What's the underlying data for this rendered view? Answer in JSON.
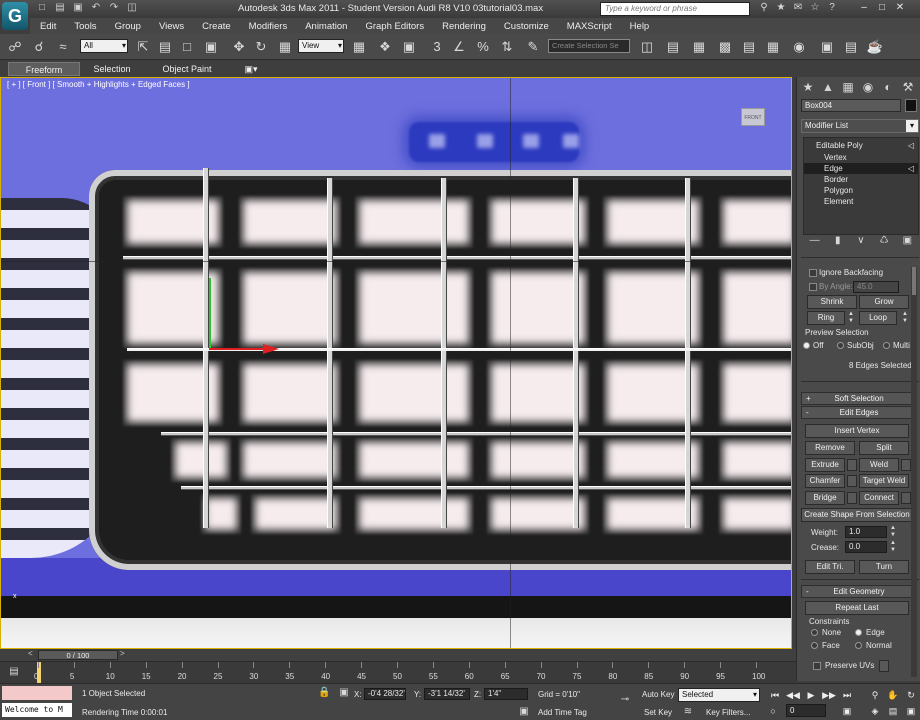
{
  "window": {
    "title": "Autodesk 3ds Max  2011   - Student Version    Audi R8 V10 03tutorial03.max",
    "search_placeholder": "Type a keyword or phrase",
    "app_logo": "G"
  },
  "menu": [
    "Edit",
    "Tools",
    "Group",
    "Views",
    "Create",
    "Modifiers",
    "Animation",
    "Graph Editors",
    "Rendering",
    "Customize",
    "MAXScript",
    "Help"
  ],
  "toolbar": {
    "selection_filter": "All",
    "ref_coord": "View",
    "named_selection_placeholder": "Create Selection Se",
    "snap_label": "3",
    "percent_label": "%"
  },
  "ribbon": {
    "tabs": [
      "Freeform",
      "Selection",
      "Object Paint"
    ],
    "active": "Freeform"
  },
  "viewport": {
    "label": "[ + ] [ Front ] [ Smooth + Highlights + Edged Faces ]",
    "viewcube_label": "FRONT",
    "axis_label": "x"
  },
  "command_panel": {
    "object_name": "Box004",
    "modifier_list": "Modifier List",
    "stack": {
      "base": "Editable Poly",
      "subs": [
        "Vertex",
        "Edge",
        "Border",
        "Polygon",
        "Element"
      ],
      "active": "Edge"
    },
    "selection": {
      "ignore_backfacing": "Ignore Backfacing",
      "by_angle": "By Angle:",
      "by_angle_value": "45.0",
      "shrink": "Shrink",
      "grow": "Grow",
      "ring": "Ring",
      "loop": "Loop",
      "preview_selection": "Preview Selection",
      "preview_options": [
        "Off",
        "SubObj",
        "Multi"
      ],
      "status": "8 Edges Selected"
    },
    "soft_selection": "Soft Selection",
    "edit_edges": {
      "title": "Edit Edges",
      "insert_vertex": "Insert Vertex",
      "remove": "Remove",
      "split": "Split",
      "extrude": "Extrude",
      "weld": "Weld",
      "chamfer": "Chamfer",
      "target_weld": "Target Weld",
      "bridge": "Bridge",
      "connect": "Connect",
      "create_shape": "Create Shape From Selection",
      "weight_label": "Weight:",
      "weight_value": "1.0",
      "crease_label": "Crease:",
      "crease_value": "0.0",
      "edit_tri": "Edit Tri.",
      "turn": "Turn"
    },
    "edit_geometry": {
      "title": "Edit Geometry",
      "repeat_last": "Repeat Last",
      "constraints": "Constraints",
      "options": [
        "None",
        "Edge",
        "Face",
        "Normal"
      ],
      "preserve_uvs": "Preserve UVs"
    }
  },
  "timeline": {
    "slider": "0 / 100",
    "ticks": [
      "0",
      "5",
      "10",
      "15",
      "20",
      "25",
      "30",
      "35",
      "40",
      "45",
      "50",
      "55",
      "60",
      "65",
      "70",
      "75",
      "80",
      "85",
      "90",
      "95",
      "100"
    ]
  },
  "status": {
    "listener_output": "Welcome to M",
    "selection": "1 Object Selected",
    "render_time": "Rendering Time  0:00:01",
    "x_label": "X:",
    "x_value": "-0'4 28/32'",
    "y_label": "Y:",
    "y_value": "-3'1 14/32'",
    "z_label": "Z:",
    "z_value": "1'4\"",
    "grid": "Grid = 0'10\"",
    "add_time_tag": "Add Time Tag",
    "auto_key": "Auto Key",
    "set_key": "Set Key",
    "key_filter": "Selected",
    "key_filters": "Key Filters...",
    "frame": "0"
  }
}
